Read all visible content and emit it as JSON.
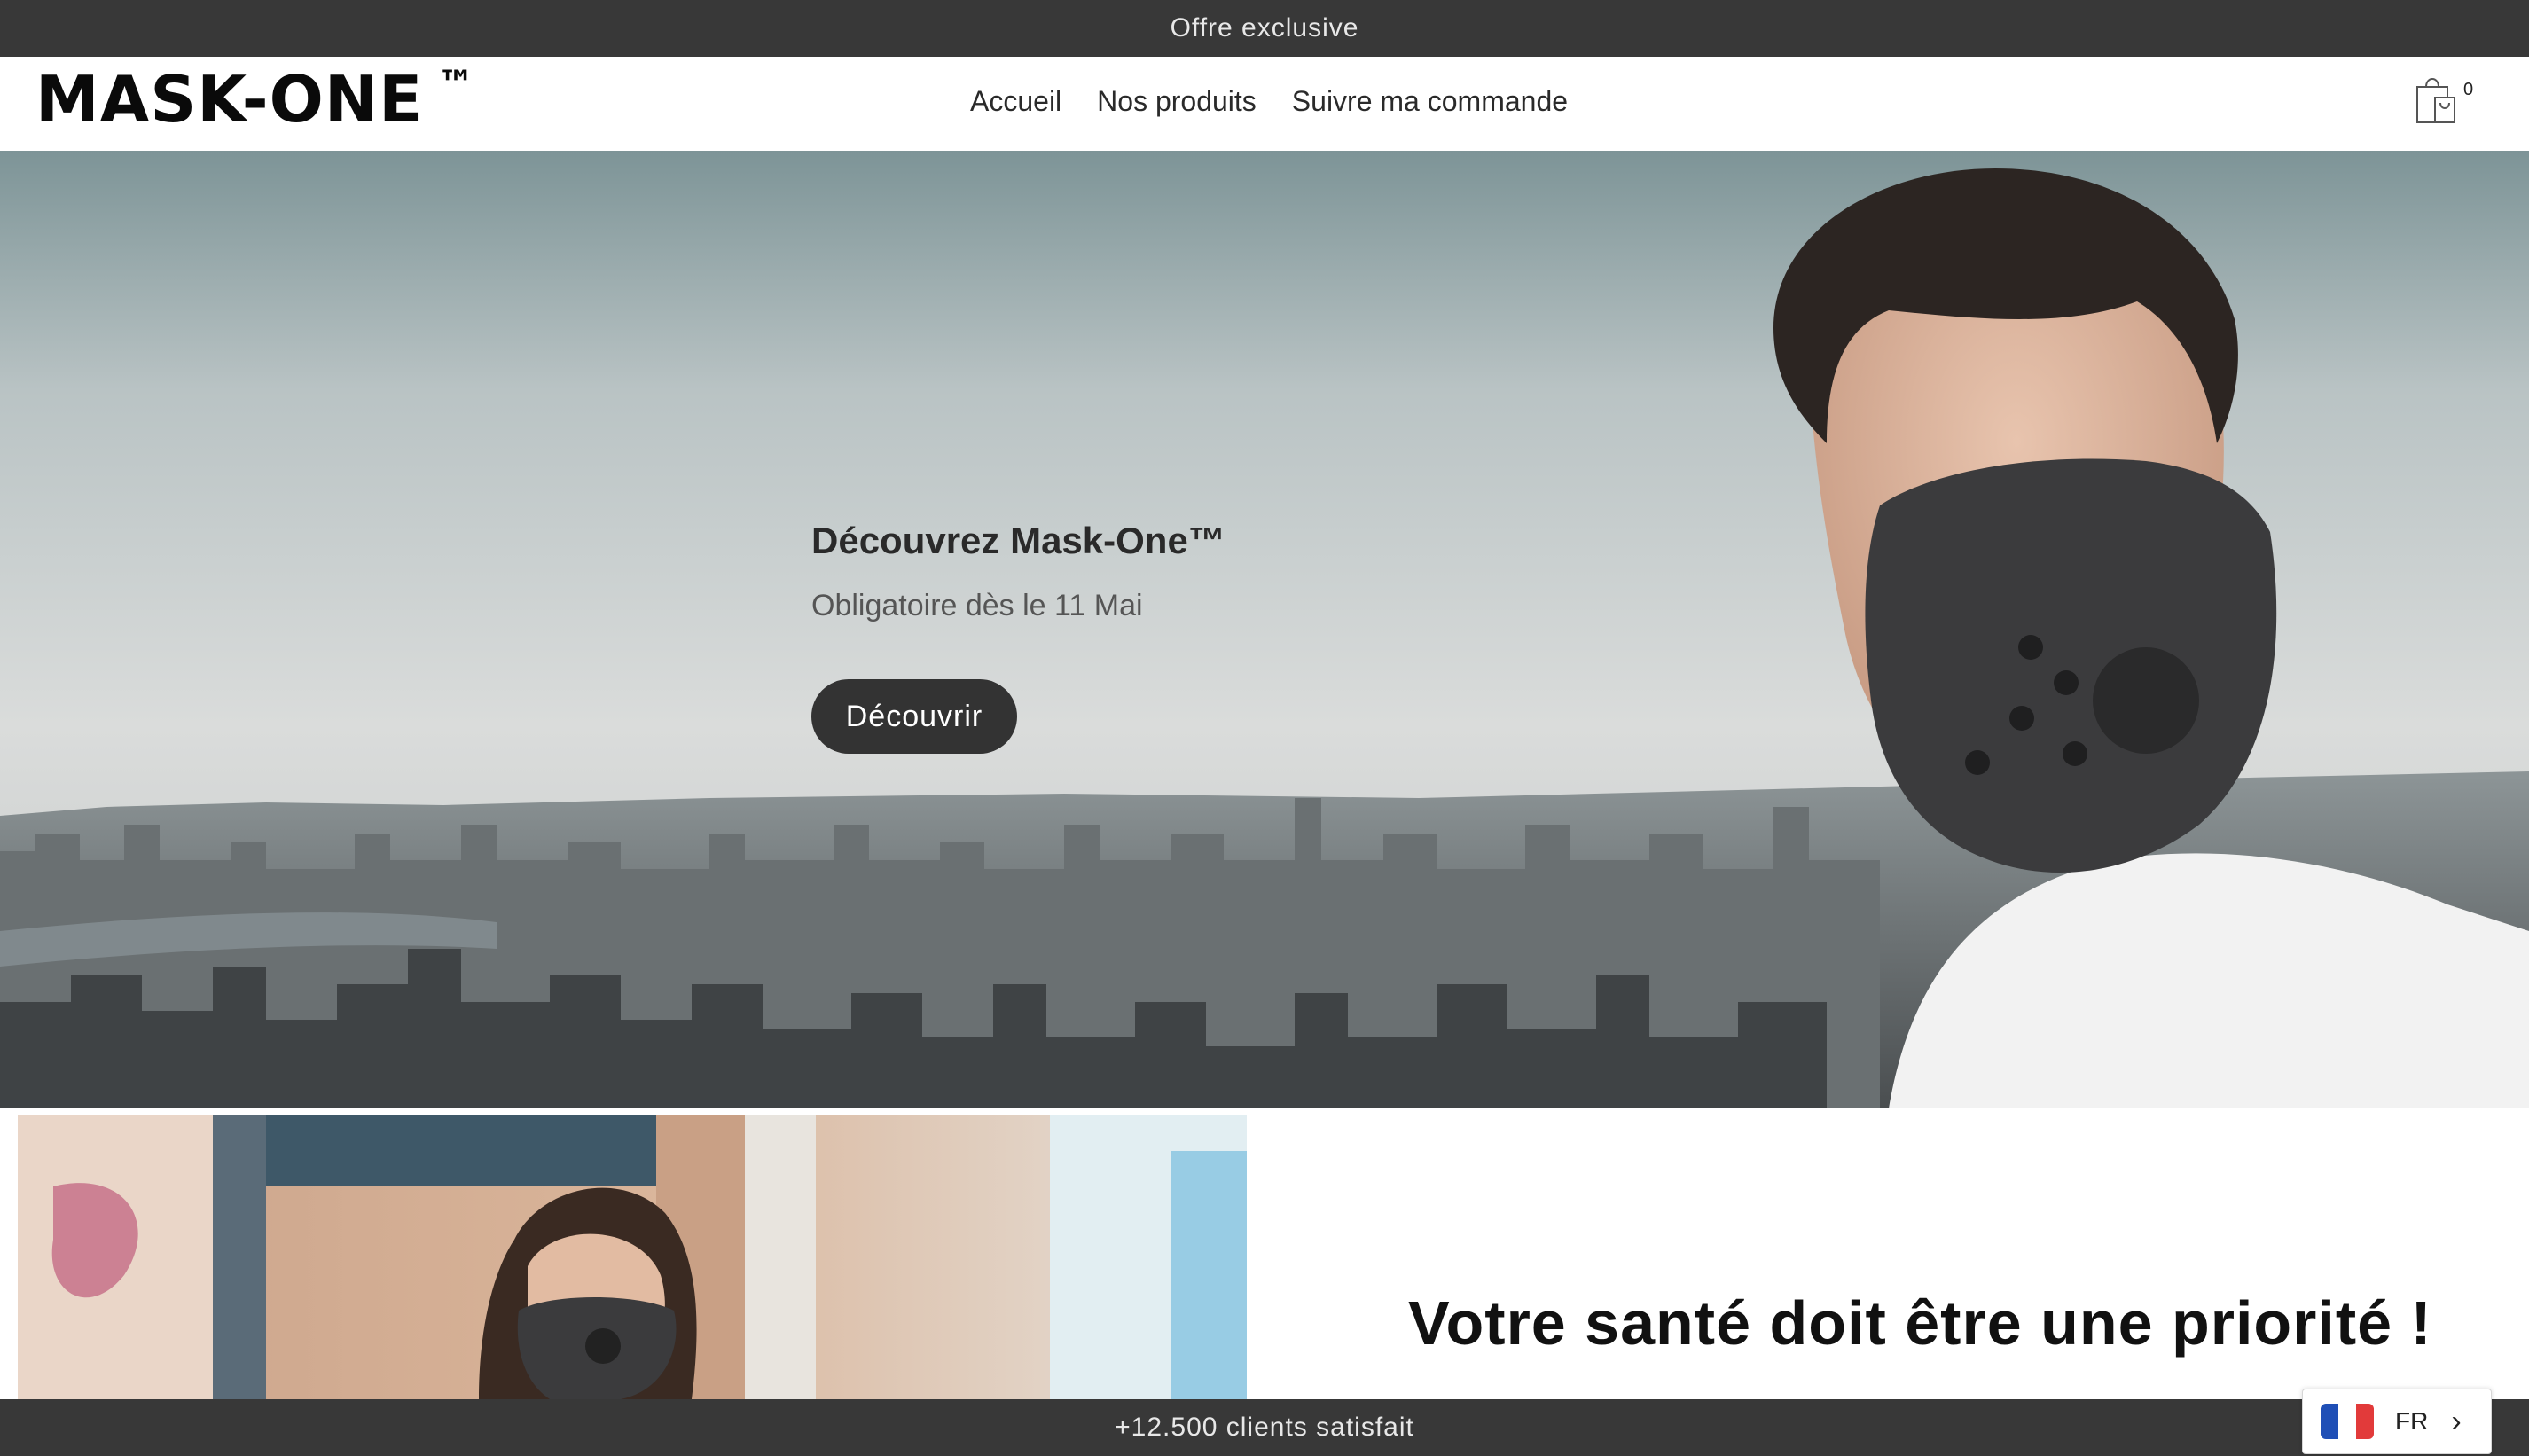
{
  "announcement": {
    "text": "Offre exclusive"
  },
  "header": {
    "logo": "MASK-ONE",
    "logo_tm": "™",
    "nav": [
      {
        "label": "Accueil"
      },
      {
        "label": "Nos produits"
      },
      {
        "label": "Suivre ma commande"
      }
    ],
    "cart_count": "0",
    "cart_icon": "shopping-bag-icon"
  },
  "hero": {
    "title": "Découvrez Mask-One™",
    "subtitle": "Obligatoire dès le 11 Mai",
    "button_label": "Découvrir"
  },
  "section": {
    "heading": "Votre santé doit être une priorité !"
  },
  "bottom_bar": {
    "text": "+12.500 clients satisfait"
  },
  "language": {
    "code": "FR",
    "flag_colors": [
      "#1f4fb6",
      "#ffffff",
      "#e23a3a"
    ]
  },
  "colors": {
    "bar": "#383838",
    "button": "#333333"
  }
}
